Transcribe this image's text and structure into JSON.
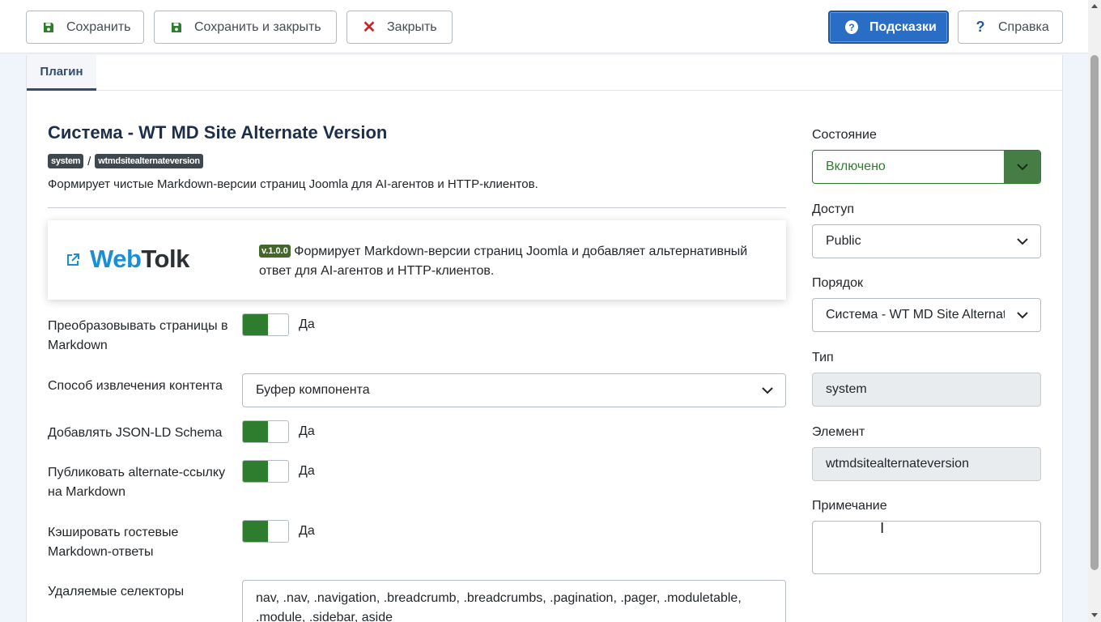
{
  "toolbar": {
    "save": "Сохранить",
    "save_close": "Сохранить и закрыть",
    "close": "Закрыть",
    "hints": "Подсказки",
    "help": "Справка"
  },
  "tabs": [
    {
      "label": "Плагин"
    }
  ],
  "plugin": {
    "title": "Система - WT MD Site Alternate Version",
    "badge_group": "system",
    "badge_slash": "/",
    "badge_element": "wtmdsitealternateversion",
    "description": "Формирует чистые Markdown-версии страниц Joomla для AI-агентов и HTTP-клиентов."
  },
  "card": {
    "logo_part1": "Web",
    "logo_part2": "Tolk",
    "version": "v.1.0.0",
    "text": "Формирует Markdown-версии страниц Joomla и добавляет альтернативный ответ для AI-агентов и HTTP-клиентов."
  },
  "fields": {
    "convert": {
      "label": "Преобразовывать страницы в Markdown",
      "value": "Да"
    },
    "extraction": {
      "label": "Способ извлечения контента",
      "value": "Буфер компонента"
    },
    "jsonld": {
      "label": "Добавлять JSON-LD Schema",
      "value": "Да"
    },
    "alternate": {
      "label": "Публиковать alternate-ссылку на Markdown",
      "value": "Да"
    },
    "cache": {
      "label": "Кэшировать гостевые Markdown-ответы",
      "value": "Да"
    },
    "selectors": {
      "label": "Удаляемые селекторы",
      "value": "nav, .nav, .navigation, .breadcrumb, .breadcrumbs, .pagination, .pager, .moduletable, .module, .sidebar, aside"
    }
  },
  "sidebar": {
    "state_label": "Состояние",
    "state_value": "Включено",
    "access_label": "Доступ",
    "access_value": "Public",
    "order_label": "Порядок",
    "order_value": "Система - WT MD Site Alternate Version",
    "type_label": "Тип",
    "type_value": "system",
    "element_label": "Элемент",
    "element_value": "wtmdsitealternateversion",
    "note_label": "Примечание",
    "note_value": ""
  },
  "colors": {
    "primary": "#2a6dc4",
    "success": "#2e7d2e",
    "brand_blue": "#1a8fd6"
  },
  "icons": [
    "save-icon",
    "close-icon",
    "question-circle-icon",
    "question-icon",
    "external-link-icon",
    "chevron-down-icon"
  ]
}
